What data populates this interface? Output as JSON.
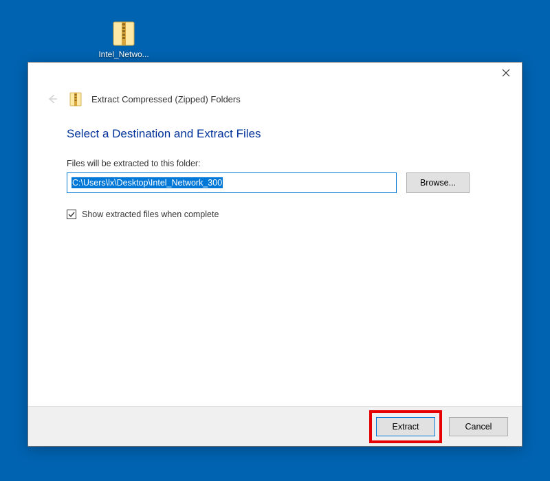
{
  "desktop": {
    "icon_label": "Intel_Netwo..."
  },
  "dialog": {
    "header": "Extract Compressed (Zipped) Folders",
    "instruction": "Select a Destination and Extract Files",
    "path_label": "Files will be extracted to this folder:",
    "path_value": "C:\\Users\\lx\\Desktop\\Intel_Network_300",
    "browse_label": "Browse...",
    "checkbox_label": "Show extracted files when complete",
    "checkbox_checked": true,
    "extract_label": "Extract",
    "cancel_label": "Cancel"
  }
}
